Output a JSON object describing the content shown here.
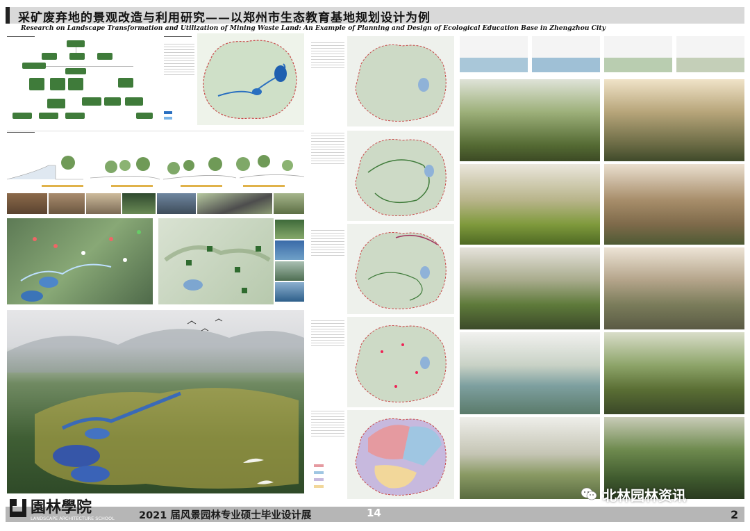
{
  "header": {
    "title_cn": "采矿废弃地的景观改造与利用研究——以郑州市生态教育基地规划设计为例",
    "title_en": "Research on Landscape Transformation and Utilization of Mining Waste Land: An Example of Planning and Design of Ecological Education Base in Zhengzhou City"
  },
  "footer": {
    "logo_cn": "園林學院",
    "logo_en": "LANDSCAPE ARCHITECTURE SCHOOL",
    "exhibition": "2021 届风景园林专业硕士毕业设计展",
    "number": "14",
    "page": "2"
  },
  "watermark": {
    "text": "北林园林资讯",
    "icon": "wechat-icon"
  },
  "colors": {
    "title_bar": "#d9d9d9",
    "footer_bar": "#b6b6b6",
    "node_green": "#3f7b3a",
    "map_outline": "#c94a4a",
    "water_blue": "#2a6fc0"
  }
}
